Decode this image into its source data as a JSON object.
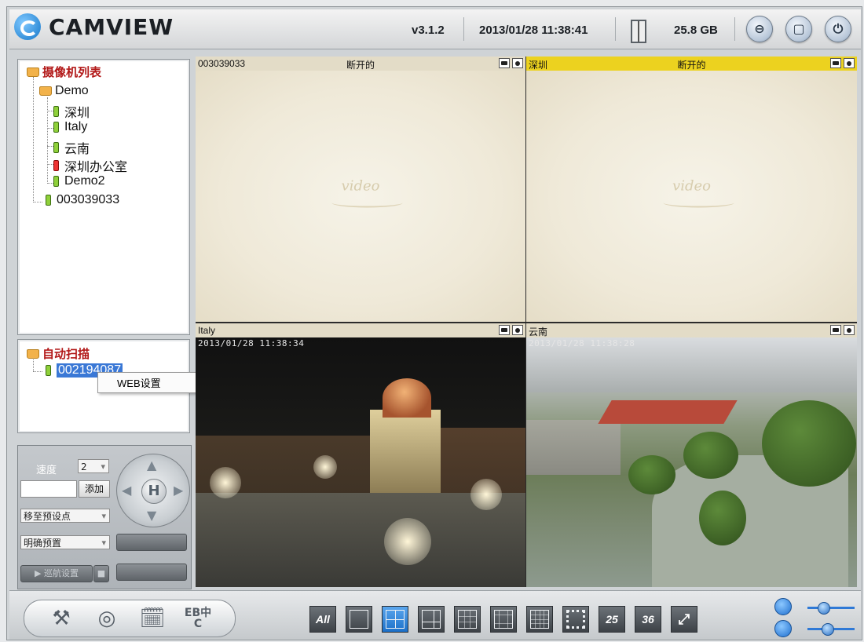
{
  "app": {
    "title": "CAMVIEW",
    "version": "v3.1.2",
    "datetime": "2013/01/28 11:38:41",
    "disk_free": "25.8 GB"
  },
  "window_buttons": [
    {
      "icon": "minimize-icon",
      "glyph": "⊖"
    },
    {
      "icon": "maximize-icon",
      "glyph": "▢"
    },
    {
      "icon": "power-icon",
      "glyph": "⏻"
    }
  ],
  "camera_tree": {
    "root_label": "摄像机列表",
    "group_label": "Demo",
    "cameras": [
      {
        "label": "深圳",
        "status": "green"
      },
      {
        "label": "Italy",
        "status": "green"
      },
      {
        "label": "云南",
        "status": "green"
      },
      {
        "label": "深圳办公室",
        "status": "red"
      },
      {
        "label": "Demo2",
        "status": "green"
      }
    ],
    "standalone": {
      "label": "003039033",
      "status": "green"
    }
  },
  "auto_scan": {
    "root_label": "自动扫描",
    "device": "002194087",
    "device_visible": "002194087"
  },
  "context_menu": {
    "item": "WEB设置"
  },
  "ptz": {
    "speed_label": "速度",
    "speed_value": "2",
    "add_button": "添加",
    "goto_preset": "移至预设点",
    "clear_preset": "明确预置",
    "cruise_settings": "巡航设置"
  },
  "panes": [
    {
      "name": "003039033",
      "status": "断开的",
      "active": false,
      "watermark": "video"
    },
    {
      "name": "深圳",
      "status": "断开的",
      "active": true,
      "watermark": "video"
    },
    {
      "name": "Italy",
      "status": "",
      "active": false,
      "timestamp": "2013/01/28 11:38:34"
    },
    {
      "name": "云南",
      "status": "",
      "active": false,
      "timestamp": "2013/01/28 11:38:28"
    }
  ],
  "bottom_tools": {
    "language_button": "EB中C"
  },
  "layouts": [
    {
      "label": "All",
      "type": "text"
    },
    {
      "label": "",
      "type": "1"
    },
    {
      "label": "",
      "type": "4",
      "selected": true
    },
    {
      "label": "",
      "type": "6"
    },
    {
      "label": "",
      "type": "9"
    },
    {
      "label": "",
      "type": "13"
    },
    {
      "label": "",
      "type": "16"
    },
    {
      "label": "",
      "type": "frame"
    },
    {
      "label": "25",
      "type": "text"
    },
    {
      "label": "36",
      "type": "text"
    },
    {
      "label": "",
      "type": "fullscreen"
    }
  ],
  "volume": {
    "mic_level": 0.28,
    "speaker_level": 0.35
  }
}
